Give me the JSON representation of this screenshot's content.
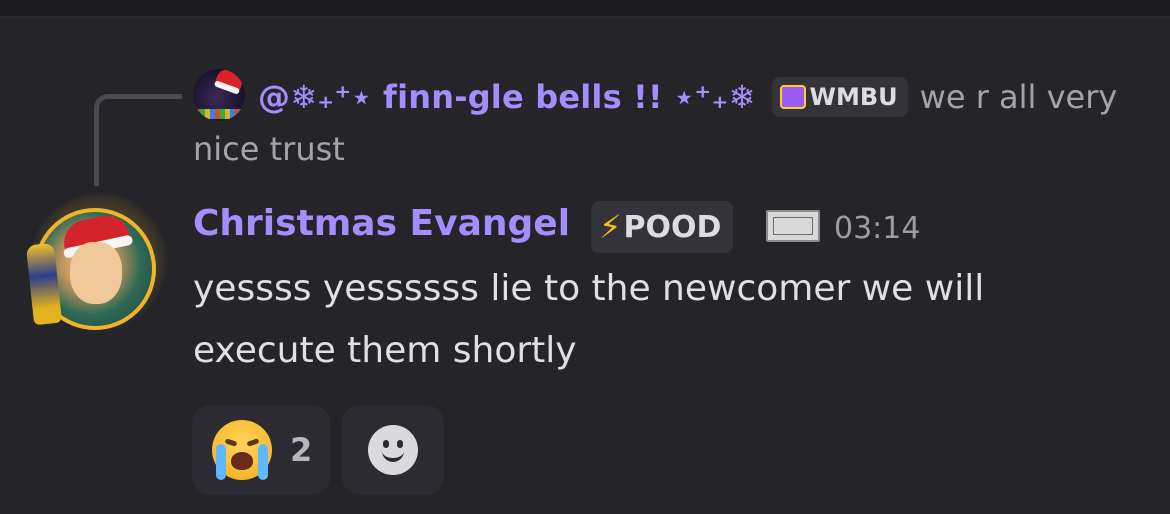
{
  "reply": {
    "author": "@❄₊⁺⋆ finn-gle bells !! ⋆⁺₊❄",
    "role_badge": "WMBU",
    "snippet_line1": "we r all very",
    "snippet_line2": "nice trust"
  },
  "message": {
    "author": "Christmas Evangel",
    "tag_badge": "POOD",
    "tag_icon": "lightning-bolt",
    "timestamp": "03:14",
    "content_line1": "yessss yessssss lie to the newcomer we will",
    "content_line2": "execute them shortly"
  },
  "reactions": [
    {
      "emoji_name": "loudly-crying-face",
      "count": "2"
    }
  ],
  "add_reaction_icon": "smiley-add-reaction",
  "colors": {
    "background": "#242429",
    "username": "#a58cff",
    "text": "#dfdfe4",
    "muted": "#a3a3ab"
  }
}
